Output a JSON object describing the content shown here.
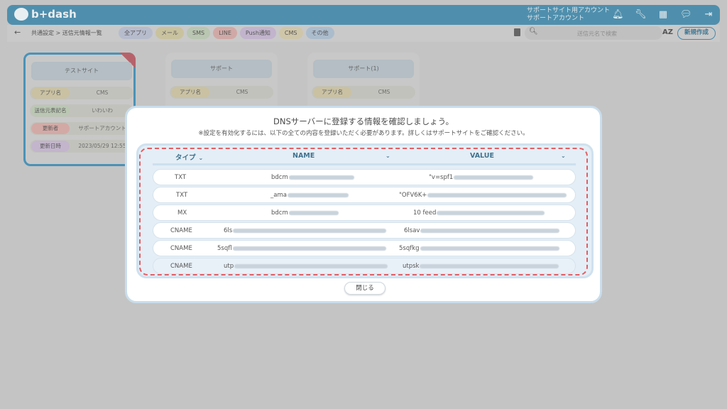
{
  "header": {
    "logo_text": "b+dash",
    "account_line1": "サポートサイト用アカウント",
    "account_line2": "サポートアカウント",
    "icons": [
      "bell-icon",
      "wrench-icon",
      "grid-icon",
      "chat-icon",
      "logout-icon"
    ]
  },
  "subnav": {
    "back": "←",
    "breadcrumb": "共通設定 > 送信元情報一覧",
    "filters": [
      {
        "label": "全アプリ",
        "color": "#b7bccd"
      },
      {
        "label": "メール",
        "color": "#c9c29f"
      },
      {
        "label": "SMS",
        "color": "#b9c6b1"
      },
      {
        "label": "LINE",
        "color": "#d0a9a6"
      },
      {
        "label": "Push通知",
        "color": "#c1b4cc"
      },
      {
        "label": "CMS",
        "color": "#cfc6a9"
      },
      {
        "label": "その他",
        "color": "#abbccd"
      }
    ],
    "search_placeholder": "送信元名で検索",
    "sort_label": "AZ",
    "new_button": "新規作成"
  },
  "cards": [
    {
      "title": "テストサイト",
      "rows": [
        {
          "label": "アプリ名",
          "value": "CMS",
          "color": "#c9c1a2"
        },
        {
          "label": "送信元表記名",
          "value": "いわいわ",
          "color": "#bac7b2"
        },
        {
          "label": "更新者",
          "value": "サポートアカウント",
          "color": "#d3a9a6"
        },
        {
          "label": "更新日時",
          "value": "2023/05/29 12:55",
          "color": "#c3b5cc"
        }
      ]
    },
    {
      "title": "サポート",
      "rows": [
        {
          "label": "アプリ名",
          "value": "CMS",
          "color": "#c9c1a2"
        }
      ]
    },
    {
      "title": "サポート(1)",
      "rows": [
        {
          "label": "アプリ名",
          "value": "CMS",
          "color": "#c9c1a2"
        }
      ]
    }
  ],
  "modal": {
    "title": "DNSサーバーに登録する情報を確認しましょう。",
    "subtitle": "※設定を有効化するには、以下の全ての内容を登録いただく必要があります。詳しくはサポートサイトをご確認ください。",
    "columns": [
      "タイプ",
      "NAME",
      "VALUE"
    ],
    "rows": [
      {
        "type": "TXT",
        "name": "bdcm",
        "value": "\"v=spf1"
      },
      {
        "type": "TXT",
        "name": "_ama",
        "value": "\"OFV6K+"
      },
      {
        "type": "MX",
        "name": "bdcm",
        "value": "10 feed"
      },
      {
        "type": "CNAME",
        "name": "6ls",
        "value": "6lsav"
      },
      {
        "type": "CNAME",
        "name": "5sqfl",
        "value": "5sqfkg"
      },
      {
        "type": "CNAME",
        "name": "utp",
        "value": "utpsk"
      }
    ],
    "close_button": "閉じる"
  }
}
